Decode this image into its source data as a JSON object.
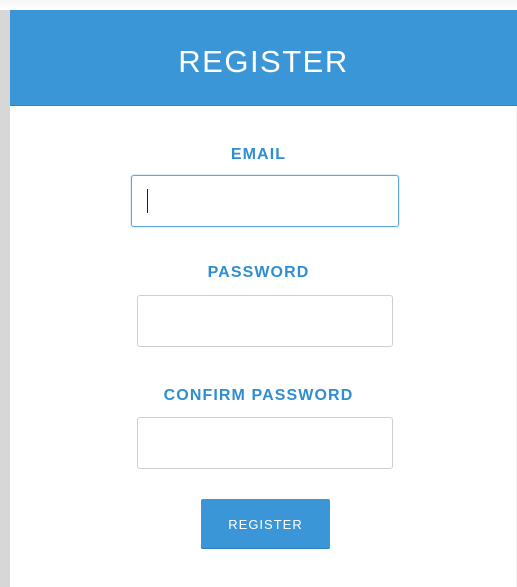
{
  "header": {
    "title": "REGISTER"
  },
  "form": {
    "email": {
      "label": "EMAIL",
      "value": "",
      "placeholder": ""
    },
    "password": {
      "label": "PASSWORD",
      "value": "",
      "placeholder": ""
    },
    "confirm_password": {
      "label": "CONFIRM PASSWORD",
      "value": "",
      "placeholder": ""
    },
    "submit_label": "REGISTER"
  },
  "colors": {
    "accent": "#3b96d8",
    "label": "#2f8ed1",
    "background": "#ffffff"
  }
}
